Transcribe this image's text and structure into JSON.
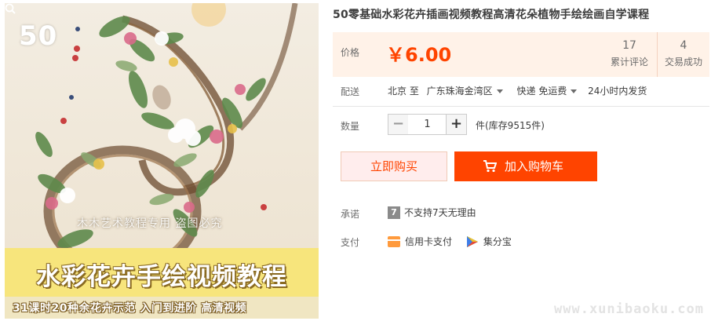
{
  "image": {
    "badge_number": "50",
    "watermark": "木木艺术教程专用 盗图必究",
    "banner_title": "水彩花卉手绘视频教程",
    "subline": "31课时20种余花卉示范   入门到进阶 高清视频"
  },
  "product": {
    "title": "50零基础水彩花卉插画视频教程高清花朵植物手绘绘画自学课程"
  },
  "price": {
    "label": "价格",
    "value": "￥6.00"
  },
  "stats": [
    {
      "count": "17",
      "label": "累计评论"
    },
    {
      "count": "4",
      "label": "交易成功"
    }
  ],
  "shipping": {
    "label": "配送",
    "from": "北京 至",
    "to": "广东珠海金湾区",
    "method": "快递 免运费",
    "dispatch": "24小时内发货"
  },
  "quantity": {
    "label": "数量",
    "value": "1",
    "minus": "−",
    "plus": "+",
    "stock": "件(库存9515件)"
  },
  "actions": {
    "buy_now": "立即购买",
    "add_to_cart": "加入购物车"
  },
  "promise": {
    "label": "承诺",
    "icon_text": "7",
    "text": "不支持7天无理由"
  },
  "payment": {
    "label": "支付",
    "credit": "信用卡支付",
    "jifenbao": "集分宝"
  },
  "site_watermark": "www.xunibaoku.com",
  "colors": {
    "accent": "#ff4400",
    "price_bg": "#fff2e8",
    "banner_yellow": "#f7e57c"
  }
}
